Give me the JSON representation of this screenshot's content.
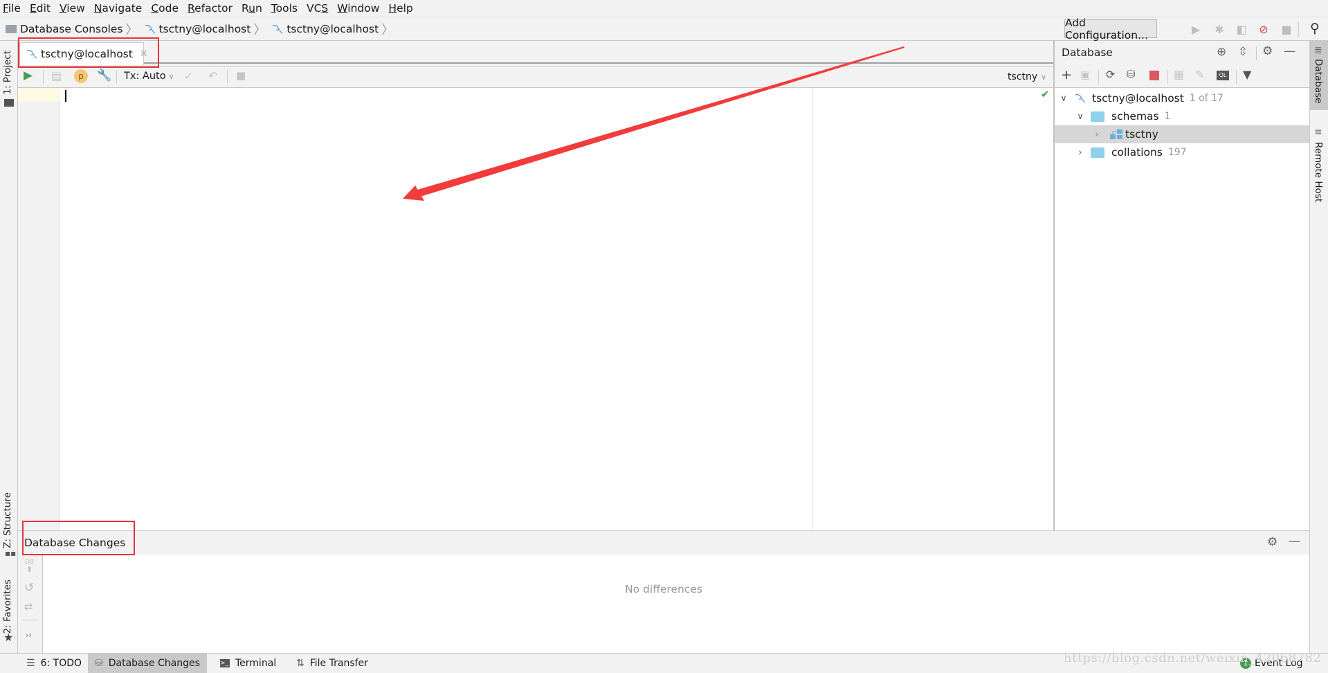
{
  "menu": [
    {
      "label": "File",
      "mnemonic": "F",
      "rest": "ile"
    },
    {
      "label": "Edit",
      "mnemonic": "E",
      "rest": "dit"
    },
    {
      "label": "View",
      "mnemonic": "V",
      "rest": "iew"
    },
    {
      "label": "Navigate",
      "mnemonic": "N",
      "rest": "avigate"
    },
    {
      "label": "Code",
      "mnemonic": "C",
      "rest": "ode"
    },
    {
      "label": "Refactor",
      "mnemonic": "R",
      "rest": "efactor"
    },
    {
      "label": "Run",
      "pre": "R",
      "mnemonic": "u",
      "rest": "n"
    },
    {
      "label": "Tools",
      "mnemonic": "T",
      "rest": "ools"
    },
    {
      "label": "VCS",
      "pre": "VC",
      "mnemonic": "S",
      "rest": ""
    },
    {
      "label": "Window",
      "mnemonic": "W",
      "rest": "indow"
    },
    {
      "label": "Help",
      "mnemonic": "H",
      "rest": "elp"
    }
  ],
  "breadcrumb": [
    "Database Consoles",
    "tsctny@localhost",
    "tsctny@localhost"
  ],
  "run_toolbar": {
    "add_configuration": "Add Configuration..."
  },
  "left_strip": {
    "project": "1: Project",
    "structure": "Z: Structure",
    "favorites": "2: Favorites"
  },
  "right_strip": {
    "database": "Database",
    "remote_host": "Remote Host"
  },
  "editor": {
    "tab_label": "tsctny@localhost",
    "tx_mode": "Tx: Auto",
    "schema_selector": "tsctny",
    "content": ""
  },
  "database_panel": {
    "title": "Database",
    "tree": [
      {
        "label": "tsctny@localhost",
        "count": "1 of 17",
        "expanded": true,
        "level": 0,
        "icon": "mysql-dolphin-icon"
      },
      {
        "label": "schemas",
        "count": "1",
        "expanded": true,
        "level": 1,
        "icon": "folder-icon"
      },
      {
        "label": "tsctny",
        "count": "",
        "expanded": false,
        "level": 2,
        "icon": "schema-icon",
        "selected": true
      },
      {
        "label": "collations",
        "count": "197",
        "expanded": false,
        "level": 1,
        "icon": "folder-icon"
      }
    ]
  },
  "bottom_panel": {
    "title": "Database Changes",
    "empty_text": "No differences",
    "side_db_label": "DB"
  },
  "status_bar": {
    "tabs": [
      {
        "label": "6: TODO",
        "icon": "list-icon"
      },
      {
        "label": "Database Changes",
        "icon": "database-changes-icon",
        "active": true
      },
      {
        "label": "Terminal",
        "icon": "terminal-icon"
      },
      {
        "label": "File Transfer",
        "icon": "file-transfer-icon"
      }
    ],
    "event_log": "Event Log",
    "event_count": "1"
  },
  "watermark": "https://blog.csdn.net/weixin_42068782",
  "colors": {
    "annotation_red": "#e6333a",
    "run_green": "#499c54",
    "stop_red": "#db5860",
    "folder_blue": "#8fd0ec"
  }
}
